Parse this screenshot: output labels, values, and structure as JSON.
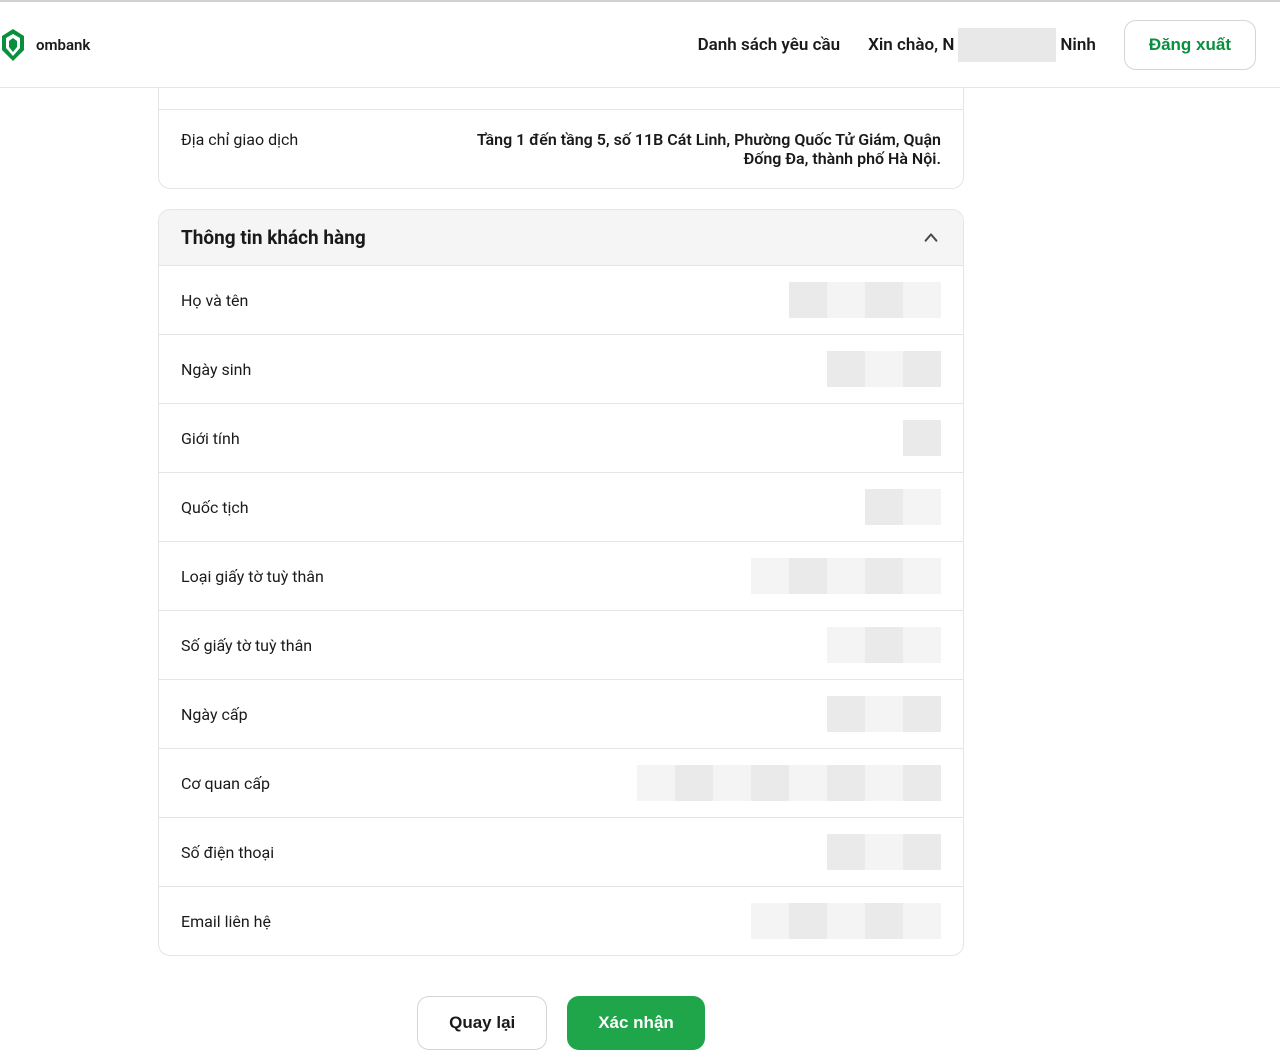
{
  "header": {
    "logo_text": "ombank",
    "nav_link": "Danh sách yêu cầu",
    "greeting_prefix": "Xin chào, N",
    "greeting_suffix": " Ninh",
    "logout": "Đăng xuất"
  },
  "address_panel": {
    "label": "Địa chỉ giao dịch",
    "value": "Tầng 1 đến tầng 5, số 11B Cát Linh, Phường Quốc Tử Giám, Quận Đống Đa, thành phố Hà Nội."
  },
  "customer_panel": {
    "title": "Thông tin khách hàng",
    "rows": [
      {
        "label": "Họ và tên"
      },
      {
        "label": "Ngày sinh"
      },
      {
        "label": "Giới tính"
      },
      {
        "label": "Quốc tịch"
      },
      {
        "label": "Loại giấy tờ tuỳ thân"
      },
      {
        "label": "Số giấy tờ tuỳ thân"
      },
      {
        "label": "Ngày cấp"
      },
      {
        "label": "Cơ quan cấp"
      },
      {
        "label": "Số điện thoại"
      },
      {
        "label": "Email liên hệ"
      }
    ]
  },
  "actions": {
    "back": "Quay lại",
    "confirm": "Xác nhận"
  }
}
